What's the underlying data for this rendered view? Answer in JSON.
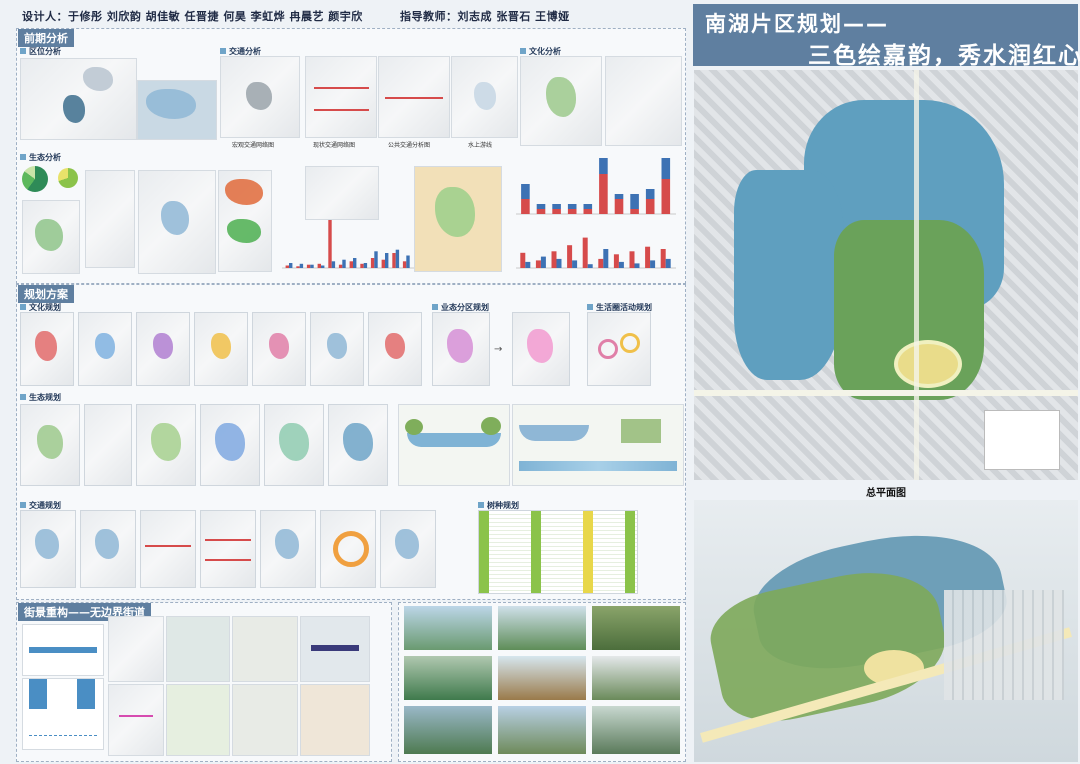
{
  "header": {
    "designers": "设计人：于修彤  刘欣韵  胡佳敏  任晋捷  何昊  李虹烨  冉晨艺  颜宇欣",
    "advisors": "指导教师：刘志成  张晋石  王博娅"
  },
  "title": {
    "line1": "南湖片区规划——",
    "line2": "三色绘嘉韵，秀水润红心"
  },
  "sections": {
    "pre_analysis": "前期分析",
    "planning": "规划方案",
    "street": "街景重构——无边界街道"
  },
  "subsections": {
    "location": "区位分析",
    "traffic": "交通分析",
    "culture": "文化分析",
    "ecology": "生态分析",
    "culture_plan": "文化规划",
    "business_zone": "业态分区规划",
    "life_circle": "生活圈活动规划",
    "eco_plan": "生态规划",
    "traffic_plan": "交通规划",
    "tree_plan": "树种规划"
  },
  "captions": {
    "traffic1": "宏观交通网络图",
    "traffic2": "现状交通网络图",
    "traffic3": "公共交通分析图",
    "traffic4": "水上游线"
  },
  "master_plan_caption": "总平面图",
  "chart_data": [
    {
      "type": "bar",
      "series": [
        {
          "name": "",
          "values": [
            15,
            5,
            5,
            5,
            5,
            40,
            15,
            5,
            15,
            35
          ]
        },
        {
          "name": "",
          "values": [
            15,
            5,
            5,
            5,
            5,
            20,
            5,
            15,
            10,
            25
          ]
        }
      ]
    },
    {
      "type": "bar",
      "series": [
        {
          "name": "",
          "values": [
            20,
            10,
            22,
            30,
            40,
            12,
            18,
            22,
            28,
            25
          ]
        },
        {
          "name": "",
          "values": [
            8,
            15,
            12,
            10,
            5,
            25,
            8,
            6,
            10,
            12
          ]
        }
      ]
    },
    {
      "type": "bar",
      "series": [
        {
          "name": "",
          "values": [
            3,
            2,
            4,
            5,
            60,
            4,
            8,
            5,
            12,
            10,
            18,
            8
          ]
        },
        {
          "name": "",
          "values": [
            6,
            5,
            4,
            3,
            8,
            10,
            12,
            6,
            20,
            18,
            22,
            15
          ]
        }
      ]
    }
  ],
  "colors": {
    "accent": "#5f7fa0",
    "water": "#7fb3d5",
    "chart_red": "#d64b4b",
    "chart_blue": "#3d72b4"
  }
}
